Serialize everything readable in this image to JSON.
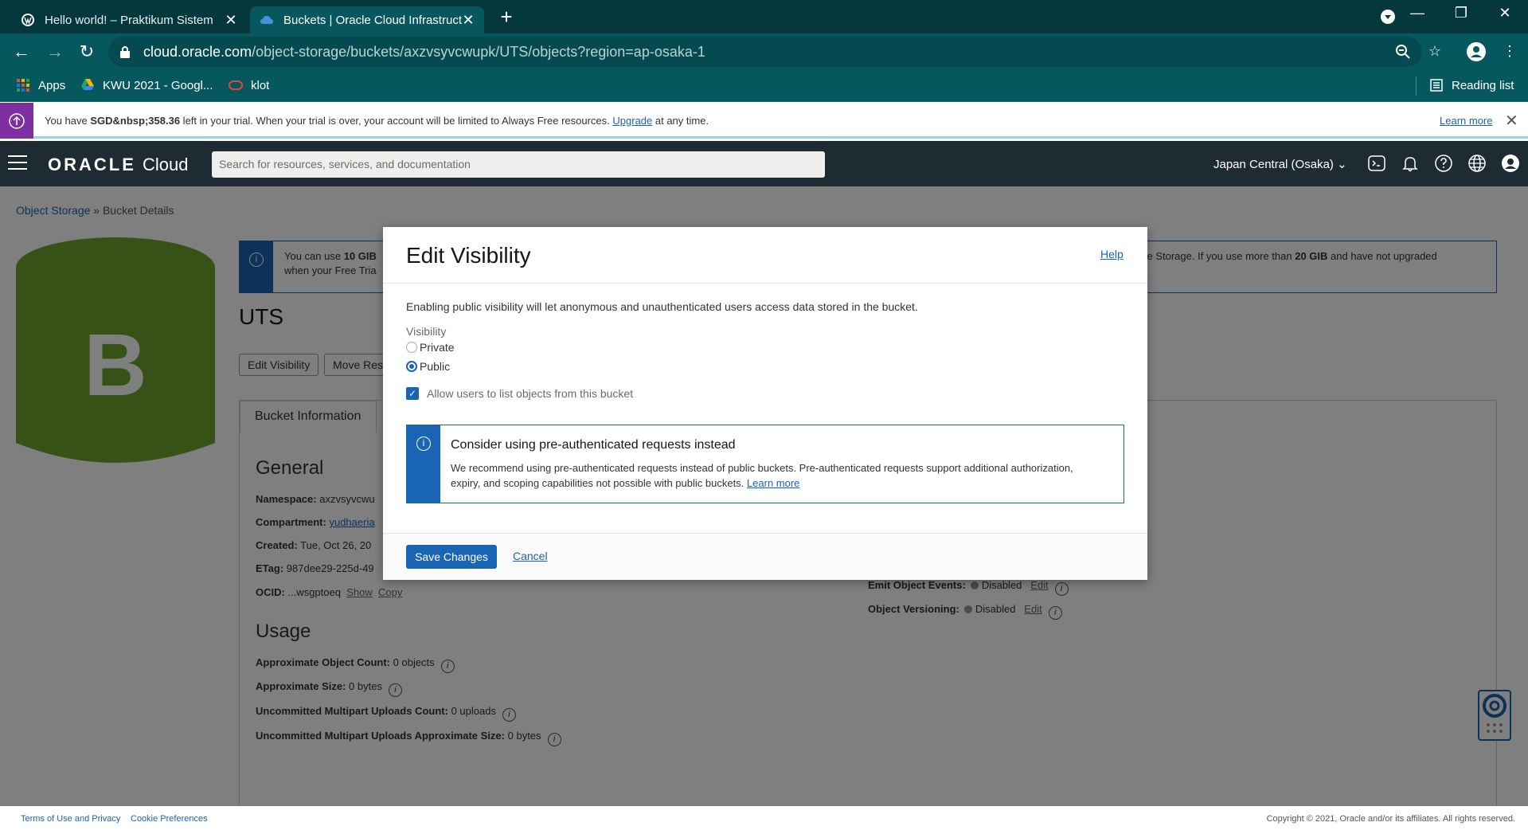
{
  "browser": {
    "tabs": [
      {
        "title": "Hello world! – Praktikum Sistem",
        "close": "✕"
      },
      {
        "title": "Buckets | Oracle Cloud Infrastruct",
        "close": "✕"
      }
    ],
    "new_tab": "+",
    "url_host": "cloud.oracle.com",
    "url_path": "/object-storage/buckets/axzvsyvcwupk/UTS/objects?region=ap-osaka-1",
    "bookmarks": [
      "Apps",
      "KWU 2021 - Googl...",
      "klot"
    ],
    "reading_list": "Reading list"
  },
  "trial_banner": {
    "text_pre": "You have ",
    "amount": "SGD&nbsp;358.36",
    "text_post": " left in your trial. When your trial is over, your account will be limited to Always Free resources. ",
    "upgrade": "Upgrade",
    "text_end": " at any time.",
    "learn_more": "Learn more"
  },
  "header": {
    "logo_oracle": "ORACLE",
    "logo_cloud": "Cloud",
    "search_placeholder": "Search for resources, services, and documentation",
    "region": "Japan Central (Osaka)"
  },
  "breadcrumb": {
    "link": "Object Storage",
    "sep": " » ",
    "current": "Bucket Details"
  },
  "bucket": {
    "letter": "B",
    "name": "UTS",
    "info_left_pre": "You can use ",
    "info_left_bold": "10 GIB",
    "info_left_l2": "when your Free Tria",
    "info_right_pre": "ve Storage. If you use more than ",
    "info_right_bold": "20 GIB",
    "info_right_post": " and have not upgraded",
    "buttons": [
      "Edit Visibility",
      "Move Res"
    ],
    "tab": "Bucket Information",
    "general": "General",
    "namespace_k": "Namespace:",
    "namespace_v": "axzvsyvcwu",
    "compartment_k": "Compartment:",
    "compartment_v": "yudhaeria",
    "created_k": "Created:",
    "created_v": "Tue, Oct 26, 20",
    "etag_k": "ETag:",
    "etag_v": "987dee29-225d-49",
    "ocid_k": "OCID:",
    "ocid_v": "...wsgptoeq",
    "show": "Show",
    "copy": "Copy",
    "emit_k": "Emit Object Events:",
    "emit_v": "Disabled",
    "emit_edit": "Edit",
    "version_k": "Object Versioning:",
    "version_v": "Disabled",
    "version_edit": "Edit",
    "usage": "Usage",
    "usage_items": [
      {
        "k": "Approximate Object Count:",
        "v": "0 objects"
      },
      {
        "k": "Approximate Size:",
        "v": "0 bytes"
      },
      {
        "k": "Uncommitted Multipart Uploads Count:",
        "v": "0 uploads"
      },
      {
        "k": "Uncommitted Multipart Uploads Approximate Size:",
        "v": "0 bytes"
      }
    ],
    "info_glyph": "i"
  },
  "footer": {
    "terms": "Terms of Use and Privacy",
    "cookies": "Cookie Preferences",
    "copyright": "Copyright © 2021, Oracle and/or its affiliates. All rights reserved."
  },
  "modal": {
    "title": "Edit Visibility",
    "help": "Help",
    "description": "Enabling public visibility will let anonymous and unauthenticated users access data stored in the bucket.",
    "visibility_label": "Visibility",
    "options": [
      "Private",
      "Public"
    ],
    "selected": "Public",
    "checkbox_label": "Allow users to list objects from this bucket",
    "checkbox_checked": true,
    "note_title": "Consider using pre-authenticated requests instead",
    "note_body": "We recommend using pre-authenticated requests instead of public buckets. Pre-authenticated requests support additional authorization, expiry, and scoping capabilities not possible with public buckets. ",
    "note_link": "Learn more",
    "save": "Save Changes",
    "cancel": "Cancel"
  },
  "colors": {
    "accent": "#1a64b4",
    "chrome_dark": "#04383c",
    "chrome": "#07575e",
    "trial_purple": "#7d2ea0",
    "bucket_green": "#6fa52c",
    "header": "#1f2b33"
  }
}
